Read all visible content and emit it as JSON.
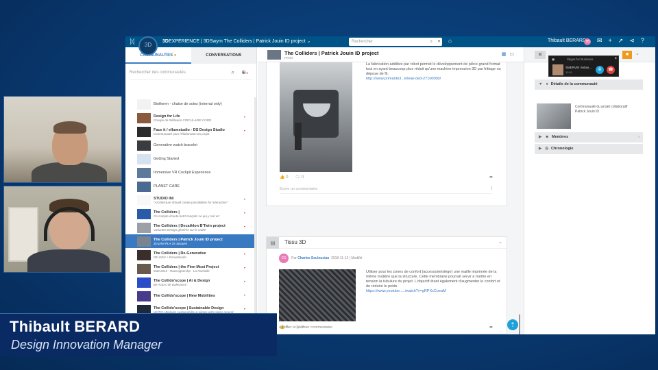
{
  "app": {
    "title_brand": "3D",
    "title_rest": "EXPERIENCE | 3DSwym The Colliders | Patrick Jouin ID project",
    "search_placeholder": "Rechercher",
    "user_name": "Thibault BERARD",
    "user_initials": "TB",
    "compass_label": "3D"
  },
  "left_panel": {
    "tab_communities": "COMMUNAUTES",
    "tab_conversations": "CONVERSATIONS",
    "search_placeholder": "Rechercher des communautés",
    "communities": [
      {
        "title": "Biotherm - chaise de soins (internal only)",
        "sub": "",
        "bold": false,
        "thumb_color": "#f2f2f2",
        "dot": false,
        "selected": false
      },
      {
        "title": "Design for Life",
        "sub": "Groupe de Réflexion CIRCULAIRE CORD",
        "bold": true,
        "thumb_color": "#8a5a3c",
        "dot": true,
        "selected": false
      },
      {
        "title": "Face it / ellumstudio - DS Design Studio",
        "sub": "Communauté pour l'élaboration du projet",
        "bold": true,
        "thumb_color": "#2b2b2b",
        "dot": true,
        "selected": false
      },
      {
        "title": "Generative watch bracelet",
        "sub": "",
        "bold": false,
        "thumb_color": "#3a3c40",
        "dot": false,
        "selected": false
      },
      {
        "title": "Getting Started",
        "sub": "",
        "bold": false,
        "thumb_color": "#d6e2ee",
        "dot": false,
        "selected": false
      },
      {
        "title": "Immersive VR Cockpit Experience",
        "sub": "",
        "bold": false,
        "thumb_color": "#5d7a98",
        "dot": false,
        "selected": false
      },
      {
        "title": "PLANET CARE",
        "sub": "",
        "bold": false,
        "thumb_color": "#4a6a90",
        "dot": false,
        "selected": false
      },
      {
        "title": "STUDIO INI",
        "sub": "\"Architecture should create possibilities for interaction\"",
        "bold": true,
        "thumb_color": "#f8f8f8",
        "dot": true,
        "selected": false
      },
      {
        "title": "The Colliders |",
        "sub": "Ce compte écoute betrt conçoits ce qui y soit art",
        "bold": true,
        "thumb_color": "#2a5ba8",
        "dot": true,
        "selected": false
      },
      {
        "title": "The Colliders | Decathlon B'Twin project",
        "sub": "Variantes Design générés sur le cadre",
        "bold": true,
        "thumb_color": "#9aa0a6",
        "dot": true,
        "selected": false
      },
      {
        "title": "The Colliders | Patrick Jouin ID project",
        "sub": "3D print PLA St-Jacques",
        "bold": true,
        "thumb_color": "#7a8490",
        "dot": false,
        "selected": true
      },
      {
        "title": "The Colliders | Re-Generative",
        "sub": "RE-GEN + Ermudstudio",
        "bold": true,
        "thumb_color": "#3a2e2a",
        "dot": true,
        "selected": false
      },
      {
        "title": "The Colliders | the Finn Most Project",
        "sub": "Matt 2016 - Racesignershp - La Rochelle",
        "bold": true,
        "thumb_color": "#6a5a4e",
        "dot": true,
        "selected": false
      },
      {
        "title": "The Collido'scope | Ai & Design",
        "sub": "Be Actors de Dalevance",
        "bold": true,
        "thumb_color": "#2a4cc8",
        "dot": true,
        "selected": false
      },
      {
        "title": "The Collido'scope | New Mobilities",
        "sub": "",
        "bold": true,
        "thumb_color": "#4a3a8a",
        "dot": true,
        "selected": false
      },
      {
        "title": "The Collido'scope | Sustainable Design",
        "sub": "WATCH Biologic sustainability & pilotes with plates around",
        "bold": true,
        "thumb_color": "#1e2a3a",
        "dot": true,
        "selected": false
      }
    ]
  },
  "center": {
    "header_title": "The Colliders | Patrick Jouin ID project",
    "header_sub": "Privée",
    "post1": {
      "text": "La fabrication additive par robot permet le développement de pièce grand format tout en ayant beaucoup plus réduit qu'une machine impression 3D par frittage ou dépose de fil.",
      "link": "http://www.primante3...k/leak-ded-27100000/",
      "likes": "0",
      "comments": "0",
      "comment_placeholder": "Écrire un commentaire"
    },
    "post2": {
      "title": "Tissu 3D",
      "avatar_initials": "CS",
      "by_prefix": "Par",
      "author": "Charles Seuleusian",
      "date": "2018-11-12 | Modifié",
      "text": "Utiliser pour les zones de confort (accessoire/siège) une maille imprimée de la même matière que la structure. Cette membrane pourrait servir à mettre en tension la tubulure du projet. L'objectif étant également d'augmenter le confort et de réduire le poids.",
      "link": "https://www.youtube...../watch?v=gRPXcCoeaM",
      "likes": "0",
      "comments": "0",
      "more_comments": "Afficher le premier commentaire"
    }
  },
  "right_panel": {
    "details_title": "Détails de la communauté",
    "details_text": "Communauté du projet collaboratif Patrick Jouin ID",
    "members_label": "Membres",
    "timeline_label": "Chronologie"
  },
  "skype": {
    "title": "Skype for Business",
    "caller": "SMERVIN Sebas...",
    "time": "13:01"
  },
  "overlay": {
    "name": "Thibault BERARD",
    "role": "Design Innovation Manager"
  }
}
